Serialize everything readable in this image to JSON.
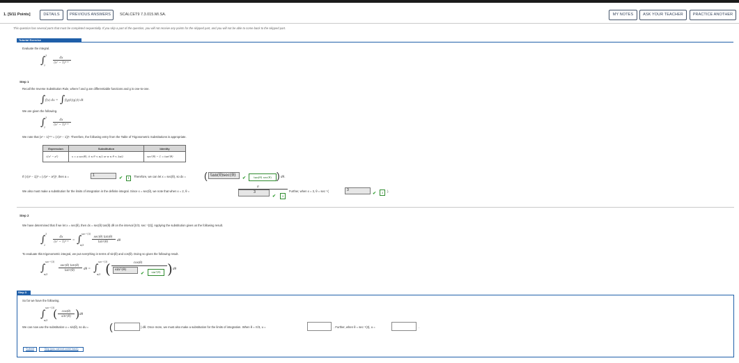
{
  "header": {
    "question_number": "1.",
    "points": "[5/11 Points]",
    "details_label": "DETAILS",
    "previous_answers_label": "PREVIOUS ANSWERS",
    "question_code": "SCALCET9 7.3.015.MI.SA.",
    "my_notes_label": "MY NOTES",
    "ask_teacher_label": "ASK YOUR TEACHER",
    "practice_label": "PRACTICE ANOTHER"
  },
  "notice": "This question has several parts that must be completed sequentially. If you skip a part of the question, you will not receive any points for the skipped part, and you will not be able to come back to the skipped part.",
  "tutorial": {
    "title": "Tutorial Exercise",
    "prompt": "Evaluate the integral.",
    "integrand_num": "dx",
    "integrand_den": "(x² − 1)³ᐟ²",
    "lower": "2",
    "upper": "3"
  },
  "step1": {
    "label": "Step 1",
    "intro": "Recall the Inverse Substitution Rule, where f and g are differentiable functions and g is one-to-one.",
    "rule_lhs": "f(x) dx =",
    "rule_rhs": "f(g(t))g′(t) dt",
    "given": "We are given the following.",
    "note_prefix": "We note that (x² − 1)³ᐟ² = (√(x² − 1))³. Therefore, the following entry from the Table of Trigonometric Substitutions is appropriate.",
    "table": {
      "headers": [
        "Expression",
        "Substitution",
        "Identity"
      ],
      "row": [
        "√(x² − a²)",
        "x = a sec(θ),   0 ≤ θ < π/2 or π ≤ θ < 3π/2",
        "sec²(θ) − 1 = tan²(θ)"
      ]
    },
    "since_text": "If (√(x² − 1))³ = (√(x² − a²))³, then a =",
    "a_value": "1",
    "a_box": "1",
    "therefore_text": "Therefore, we can let x = sec(θ), so dx =",
    "dx_value": "tan(θ)sec(θ)",
    "dx_box": "tan(θ) sec(θ)",
    "dtheta": "dθ.",
    "limits_text": "We also must make a substitution for the limits of integration in the definite integral. Since x = sec(θ), we note that when x = 2, θ =",
    "pi_top": "π",
    "pi_bottom": "3",
    "pi_box": "3",
    "further_text": "Further, when x = 3, θ = sec⁻¹(",
    "sec_value": "3",
    "sec_box": "3",
    "close": ")."
  },
  "step2": {
    "label": "Step 2",
    "intro": "We have determined that if we let x = sec(θ), then dx = sec(θ) tan(θ) dθ on the interval [π/3, sec⁻¹(3)]. Applying the substitution gives us the following result.",
    "sub_num": "sec(θ) tan(θ)",
    "sub_den": "tan³(θ)",
    "upper": "sec⁻¹(3)",
    "lower": "π/3",
    "eval_text": "To evaluate this trigonometric integral, we put everything in terms of sin(θ) and cos(θ). Doing so gives the following result.",
    "cos_num": "cos(θ)",
    "sin_answer": "sin²(θ)",
    "sin_box": "sin²(θ)"
  },
  "step3": {
    "label": "Step 3",
    "intro": "So far we have the following.",
    "frac_num": "cos(θ)",
    "frac_den": "sin²(θ)",
    "upper": "sec⁻¹(3)",
    "lower": "π/3",
    "sub_text": "We can now use the substitution u = sin(θ), so du =",
    "once_more": ") dθ. Once more, we must also make a substitution for the limits of integration. When θ = π/3, u =",
    "further": ". Further, when θ = sec⁻¹(3), u =",
    "end": ".",
    "submit_label": "Submit",
    "skip_label": "Skip (you cannot come back)"
  }
}
